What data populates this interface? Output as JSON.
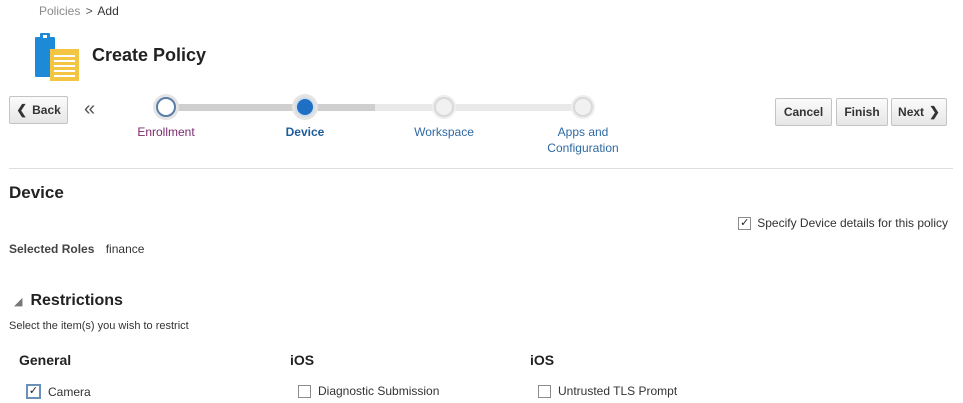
{
  "breadcrumb": {
    "parent": "Policies",
    "separator": ">",
    "current": "Add"
  },
  "page": {
    "title": "Create Policy"
  },
  "nav": {
    "back_label": "Back",
    "back_icon": "chevron-left-icon",
    "collapse_glyph": "«",
    "cancel_label": "Cancel",
    "finish_label": "Finish",
    "next_label": "Next",
    "next_icon": "chevron-right-icon"
  },
  "train": {
    "steps": [
      {
        "label": "Enrollment",
        "state": "visited"
      },
      {
        "label": "Device",
        "state": "current"
      },
      {
        "label": "Workspace",
        "state": "unvisited"
      },
      {
        "label": "Apps and Configuration",
        "state": "unvisited"
      }
    ]
  },
  "section": {
    "title": "Device",
    "specify_label": "Specify Device details for this policy",
    "specify_checked": true,
    "roles_label": "Selected Roles",
    "roles_value": "finance"
  },
  "restrictions": {
    "title": "Restrictions",
    "hint": "Select the item(s) you wish to restrict",
    "columns": [
      {
        "heading": "General",
        "item": "Camera",
        "checked": true
      },
      {
        "heading": "iOS",
        "item": "Diagnostic Submission",
        "checked": false
      },
      {
        "heading": "iOS",
        "item": "Untrusted TLS Prompt",
        "checked": false
      }
    ]
  },
  "colors": {
    "accent": "#1f6fc4",
    "visited": "#7a2a6c",
    "link": "#2f6aa3",
    "icon_blue": "#1d8ad8",
    "icon_yellow": "#f4c542"
  }
}
